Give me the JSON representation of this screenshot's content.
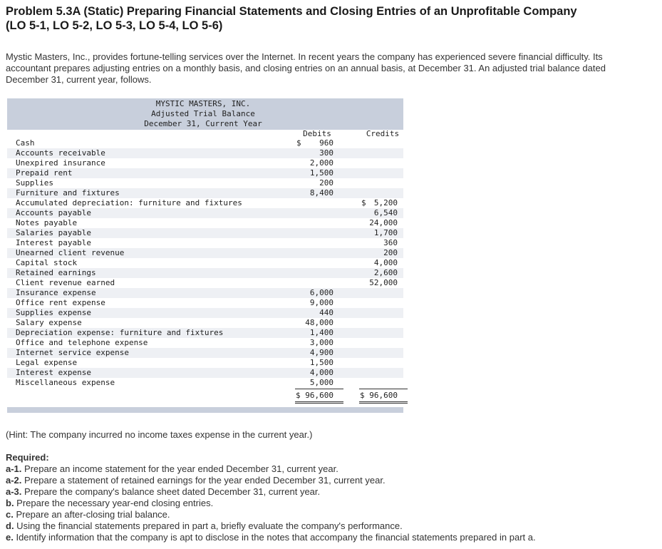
{
  "title_line1": "Problem 5.3A (Static) Preparing Financial Statements and Closing Entries of an Unprofitable Company",
  "title_line2": "(LO 5-1, LO 5-2, LO 5-3, LO 5-4, LO 5-6)",
  "intro": "Mystic Masters, Inc., provides fortune-telling services over the Internet. In recent years the company has experienced severe financial difficulty. Its accountant prepares adjusting entries on a monthly basis, and closing entries on an annual basis, at December 31. An adjusted trial balance dated December 31, current year, follows.",
  "trial_balance": {
    "company": "MYSTIC MASTERS, INC.",
    "report": "Adjusted Trial Balance",
    "date": "December 31, Current Year",
    "debits_header": "Debits",
    "credits_header": "Credits",
    "dollar": "$",
    "rows": [
      {
        "account": "Cash",
        "debit": "960",
        "credit": ""
      },
      {
        "account": "Accounts receivable",
        "debit": "300",
        "credit": ""
      },
      {
        "account": "Unexpired insurance",
        "debit": "2,000",
        "credit": ""
      },
      {
        "account": "Prepaid rent",
        "debit": "1,500",
        "credit": ""
      },
      {
        "account": "Supplies",
        "debit": "200",
        "credit": ""
      },
      {
        "account": "Furniture and fixtures",
        "debit": "8,400",
        "credit": ""
      },
      {
        "account": "Accumulated depreciation: furniture and fixtures",
        "debit": "",
        "credit": "5,200"
      },
      {
        "account": "Accounts payable",
        "debit": "",
        "credit": "6,540"
      },
      {
        "account": "Notes payable",
        "debit": "",
        "credit": "24,000"
      },
      {
        "account": "Salaries payable",
        "debit": "",
        "credit": "1,700"
      },
      {
        "account": "Interest payable",
        "debit": "",
        "credit": "360"
      },
      {
        "account": "Unearned client revenue",
        "debit": "",
        "credit": "200"
      },
      {
        "account": "Capital stock",
        "debit": "",
        "credit": "4,000"
      },
      {
        "account": "Retained earnings",
        "debit": "",
        "credit": "2,600"
      },
      {
        "account": "Client revenue earned",
        "debit": "",
        "credit": "52,000"
      },
      {
        "account": "Insurance expense",
        "debit": "6,000",
        "credit": ""
      },
      {
        "account": "Office rent expense",
        "debit": "9,000",
        "credit": ""
      },
      {
        "account": "Supplies expense",
        "debit": "440",
        "credit": ""
      },
      {
        "account": "Salary expense",
        "debit": "48,000",
        "credit": ""
      },
      {
        "account": "Depreciation expense: furniture and fixtures",
        "debit": "1,400",
        "credit": ""
      },
      {
        "account": "Office and telephone expense",
        "debit": "3,000",
        "credit": ""
      },
      {
        "account": "Internet service expense",
        "debit": "4,900",
        "credit": ""
      },
      {
        "account": "Legal expense",
        "debit": "1,500",
        "credit": ""
      },
      {
        "account": "Interest expense",
        "debit": "4,000",
        "credit": ""
      },
      {
        "account": "Miscellaneous expense",
        "debit": "5,000",
        "credit": ""
      }
    ],
    "total_debits": "$ 96,600",
    "total_credits": "$ 96,600"
  },
  "hint": "(Hint: The company incurred no income taxes expense in the current year.)",
  "required_label": "Required:",
  "requirements": [
    {
      "label": "a-1.",
      "text": " Prepare an income statement for the year ended December 31, current year."
    },
    {
      "label": "a-2.",
      "text": " Prepare a statement of retained earnings for the year ended December 31, current year."
    },
    {
      "label": "a-3.",
      "text": " Prepare the company's balance sheet dated December 31, current year."
    },
    {
      "label": "b.",
      "text": " Prepare the necessary year-end closing entries."
    },
    {
      "label": "c.",
      "text": " Prepare an after-closing trial balance."
    },
    {
      "label": "d.",
      "text": " Using the financial statements prepared in part a, briefly evaluate the company's performance."
    },
    {
      "label": "e.",
      "text": " Identify information that the company is apt to disclose in the notes that accompany the financial statements prepared in part a."
    }
  ]
}
